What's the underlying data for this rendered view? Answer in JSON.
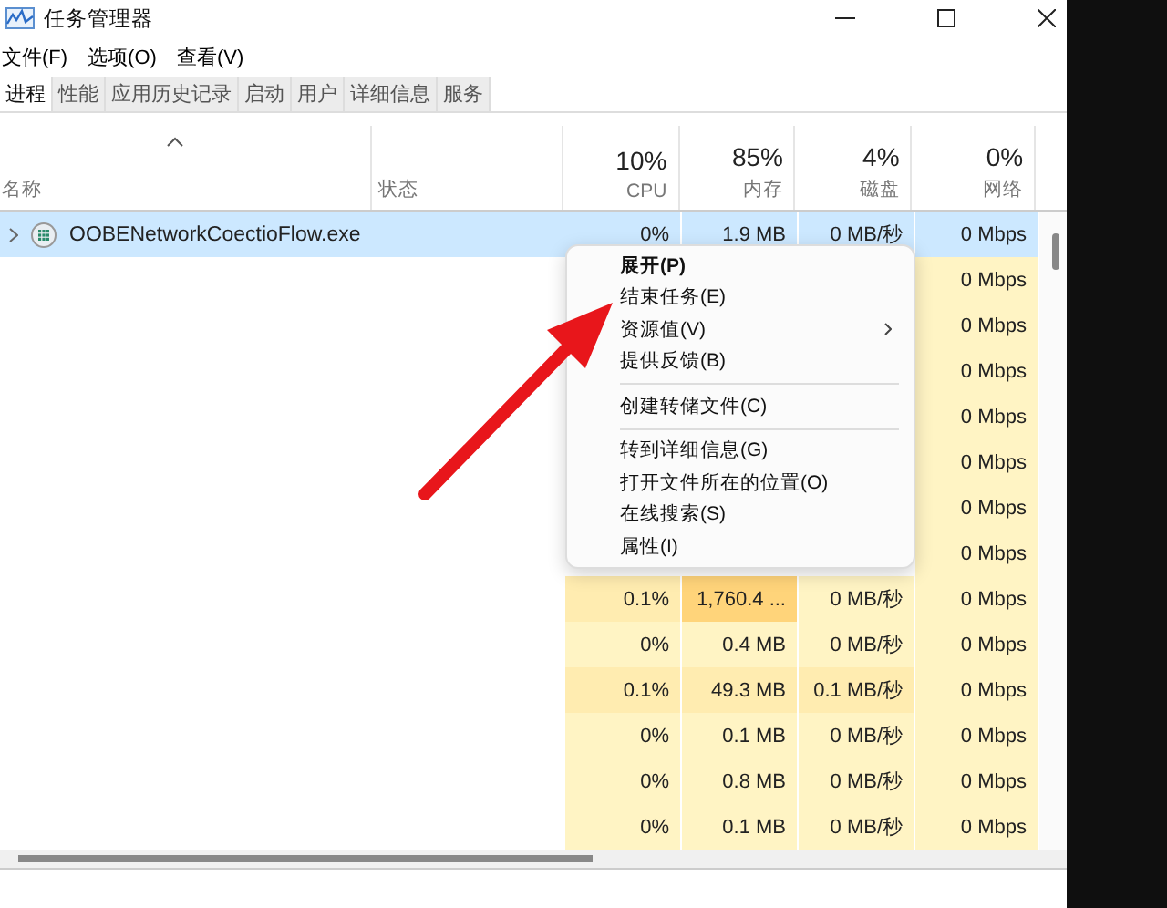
{
  "window": {
    "title": "任务管理器"
  },
  "menu": [
    "文件(F)",
    "选项(O)",
    "查看(V)"
  ],
  "tabs": [
    {
      "label": "进程",
      "selected": true
    },
    {
      "label": "性能",
      "selected": false
    },
    {
      "label": "应用历史记录",
      "selected": false
    },
    {
      "label": "启动",
      "selected": false
    },
    {
      "label": "用户",
      "selected": false
    },
    {
      "label": "详细信息",
      "selected": false
    },
    {
      "label": "服务",
      "selected": false
    }
  ],
  "columns": [
    {
      "label": "名称",
      "kind": "name"
    },
    {
      "label": "状态",
      "kind": "status"
    },
    {
      "usage": "10%",
      "label": "CPU",
      "kind": "metric"
    },
    {
      "usage": "85%",
      "label": "内存",
      "kind": "metric"
    },
    {
      "usage": "4%",
      "label": "磁盘",
      "kind": "metric"
    },
    {
      "usage": "0%",
      "label": "网络",
      "kind": "metric"
    }
  ],
  "rows": [
    {
      "name": "OOBENetworkCoectioFlow.exe",
      "selected": true,
      "cells": [
        {
          "text": "0%"
        },
        {
          "text": "1.9 MB"
        },
        {
          "text": "0 MB/秒"
        },
        {
          "text": "0 Mbps"
        }
      ]
    },
    {
      "selected": false,
      "cells": [
        null,
        null,
        null,
        {
          "text": "0 Mbps",
          "color": "#fff4c4"
        }
      ]
    },
    {
      "selected": false,
      "cells": [
        null,
        null,
        null,
        {
          "text": "0 Mbps",
          "color": "#fff4c4"
        }
      ]
    },
    {
      "selected": false,
      "cells": [
        null,
        null,
        null,
        {
          "text": "0 Mbps",
          "color": "#fff4c4"
        }
      ]
    },
    {
      "selected": false,
      "cells": [
        null,
        null,
        null,
        {
          "text": "0 Mbps",
          "color": "#fff4c4"
        }
      ]
    },
    {
      "selected": false,
      "cells": [
        null,
        null,
        null,
        {
          "text": "0 Mbps",
          "color": "#fff4c4"
        }
      ]
    },
    {
      "selected": false,
      "cells": [
        null,
        null,
        null,
        {
          "text": "0 Mbps",
          "color": "#fff4c4"
        }
      ]
    },
    {
      "selected": false,
      "cells": [
        null,
        null,
        null,
        {
          "text": "0 Mbps",
          "color": "#fff4c4"
        }
      ]
    },
    {
      "selected": false,
      "cells": [
        {
          "text": "0.1%",
          "color": "#ffecb0"
        },
        {
          "text": "1,760.4 ...",
          "color": "#ffd47a"
        },
        {
          "text": "0 MB/秒",
          "color": "#fff4c4"
        },
        {
          "text": "0 Mbps",
          "color": "#fff4c4"
        }
      ]
    },
    {
      "selected": false,
      "cells": [
        {
          "text": "0%",
          "color": "#fff4c4"
        },
        {
          "text": "0.4 MB",
          "color": "#fff4c4"
        },
        {
          "text": "0 MB/秒",
          "color": "#fff4c4"
        },
        {
          "text": "0 Mbps",
          "color": "#fff4c4"
        }
      ]
    },
    {
      "selected": false,
      "cells": [
        {
          "text": "0.1%",
          "color": "#ffecb0"
        },
        {
          "text": "49.3 MB",
          "color": "#ffecb0"
        },
        {
          "text": "0.1 MB/秒",
          "color": "#ffecb0"
        },
        {
          "text": "0 Mbps",
          "color": "#fff4c4"
        }
      ]
    },
    {
      "selected": false,
      "cells": [
        {
          "text": "0%",
          "color": "#fff4c4"
        },
        {
          "text": "0.1 MB",
          "color": "#fff4c4"
        },
        {
          "text": "0 MB/秒",
          "color": "#fff4c4"
        },
        {
          "text": "0 Mbps",
          "color": "#fff4c4"
        }
      ]
    },
    {
      "selected": false,
      "cells": [
        {
          "text": "0%",
          "color": "#fff4c4"
        },
        {
          "text": "0.8 MB",
          "color": "#fff4c4"
        },
        {
          "text": "0 MB/秒",
          "color": "#fff4c4"
        },
        {
          "text": "0 Mbps",
          "color": "#fff4c4"
        }
      ]
    },
    {
      "selected": false,
      "cells": [
        {
          "text": "0%",
          "color": "#fff4c4"
        },
        {
          "text": "0.1 MB",
          "color": "#fff4c4"
        },
        {
          "text": "0 MB/秒",
          "color": "#fff4c4"
        },
        {
          "text": "0 Mbps",
          "color": "#fff4c4"
        }
      ]
    }
  ],
  "context_menu": [
    {
      "kind": "item",
      "label": "展开(P)",
      "bold": true,
      "submenu": false
    },
    {
      "kind": "item",
      "label": "结束任务(E)",
      "bold": false,
      "submenu": false
    },
    {
      "kind": "item",
      "label": "资源值(V)",
      "bold": false,
      "submenu": true
    },
    {
      "kind": "item",
      "label": "提供反馈(B)",
      "bold": false,
      "submenu": false
    },
    {
      "kind": "separator"
    },
    {
      "kind": "item",
      "label": "创建转储文件(C)",
      "bold": false,
      "submenu": false
    },
    {
      "kind": "separator"
    },
    {
      "kind": "item",
      "label": "转到详细信息(G)",
      "bold": false,
      "submenu": false
    },
    {
      "kind": "item",
      "label": "打开文件所在的位置(O)",
      "bold": false,
      "submenu": false
    },
    {
      "kind": "item",
      "label": "在线搜索(S)",
      "bold": false,
      "submenu": false
    },
    {
      "kind": "item",
      "label": "属性(I)",
      "bold": false,
      "submenu": false
    }
  ]
}
